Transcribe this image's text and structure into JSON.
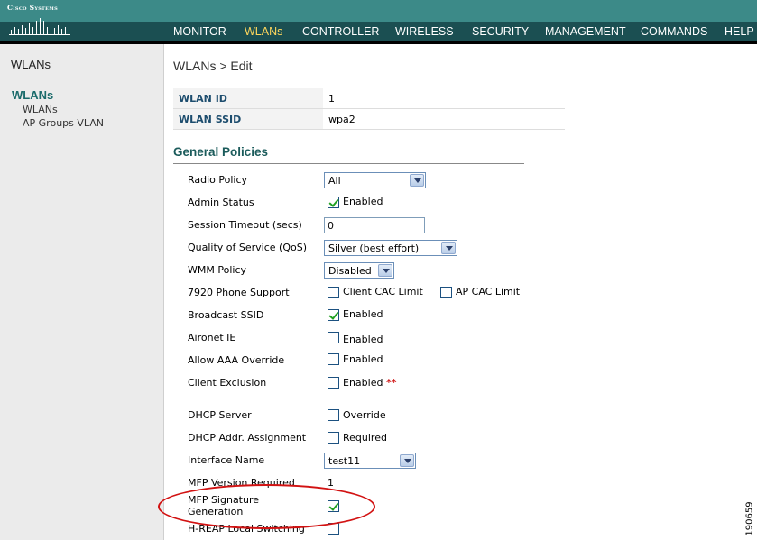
{
  "header": {
    "logo_text": "Cisco Systems",
    "nav": [
      {
        "label": "MONITOR",
        "active": false
      },
      {
        "label": "WLANs",
        "active": true
      },
      {
        "label": "CONTROLLER",
        "active": false
      },
      {
        "label": "WIRELESS",
        "active": false
      },
      {
        "label": "SECURITY",
        "active": false
      },
      {
        "label": "MANAGEMENT",
        "active": false
      },
      {
        "label": "COMMANDS",
        "active": false
      },
      {
        "label": "HELP",
        "active": false
      }
    ]
  },
  "sidebar": {
    "title": "WLANs",
    "section": "WLANs",
    "items": [
      "WLANs",
      "AP Groups VLAN"
    ]
  },
  "page": {
    "title": "WLANs > Edit",
    "wlan_id_label": "WLAN ID",
    "wlan_id_value": "1",
    "wlan_ssid_label": "WLAN SSID",
    "wlan_ssid_value": "wpa2",
    "section_title": "General Policies"
  },
  "form": {
    "radio_policy": {
      "label": "Radio Policy",
      "value": "All"
    },
    "admin_status": {
      "label": "Admin Status",
      "checked": true,
      "text": "Enabled"
    },
    "session_timeout": {
      "label": "Session Timeout (secs)",
      "value": "0"
    },
    "qos": {
      "label": "Quality of Service (QoS)",
      "value": "Silver (best effort)"
    },
    "wmm_policy": {
      "label": "WMM Policy",
      "value": "Disabled"
    },
    "phone_support": {
      "label": "7920 Phone Support",
      "client_cac": "Client CAC Limit",
      "client_cac_checked": false,
      "ap_cac": "AP CAC Limit",
      "ap_cac_checked": false
    },
    "broadcast_ssid": {
      "label": "Broadcast SSID",
      "checked": true,
      "text": "Enabled"
    },
    "aironet_ie": {
      "label": "Aironet IE",
      "checked": false,
      "text": "Enabled"
    },
    "aaa_override": {
      "label": "Allow AAA Override",
      "checked": false,
      "text": "Enabled"
    },
    "client_exclusion": {
      "label": "Client Exclusion",
      "checked": false,
      "text": "Enabled",
      "marker": "**"
    },
    "dhcp_server": {
      "label": "DHCP Server",
      "checked": false,
      "text": "Override"
    },
    "dhcp_assignment": {
      "label": "DHCP Addr. Assignment",
      "checked": false,
      "text": "Required"
    },
    "interface_name": {
      "label": "Interface Name",
      "value": "test11"
    },
    "mfp_version": {
      "label": "MFP Version Required",
      "value": "1"
    },
    "mfp_signature": {
      "label_line1": "MFP Signature",
      "label_line2": "Generation",
      "checked": true
    },
    "hreap": {
      "label": "H-REAP Local Switching",
      "checked": false
    }
  },
  "figure_id": "190659",
  "colors": {
    "header_top": "#3c8a88",
    "header_nav": "#1b4f52",
    "nav_active": "#ffd75c",
    "annotation": "#d21212"
  }
}
